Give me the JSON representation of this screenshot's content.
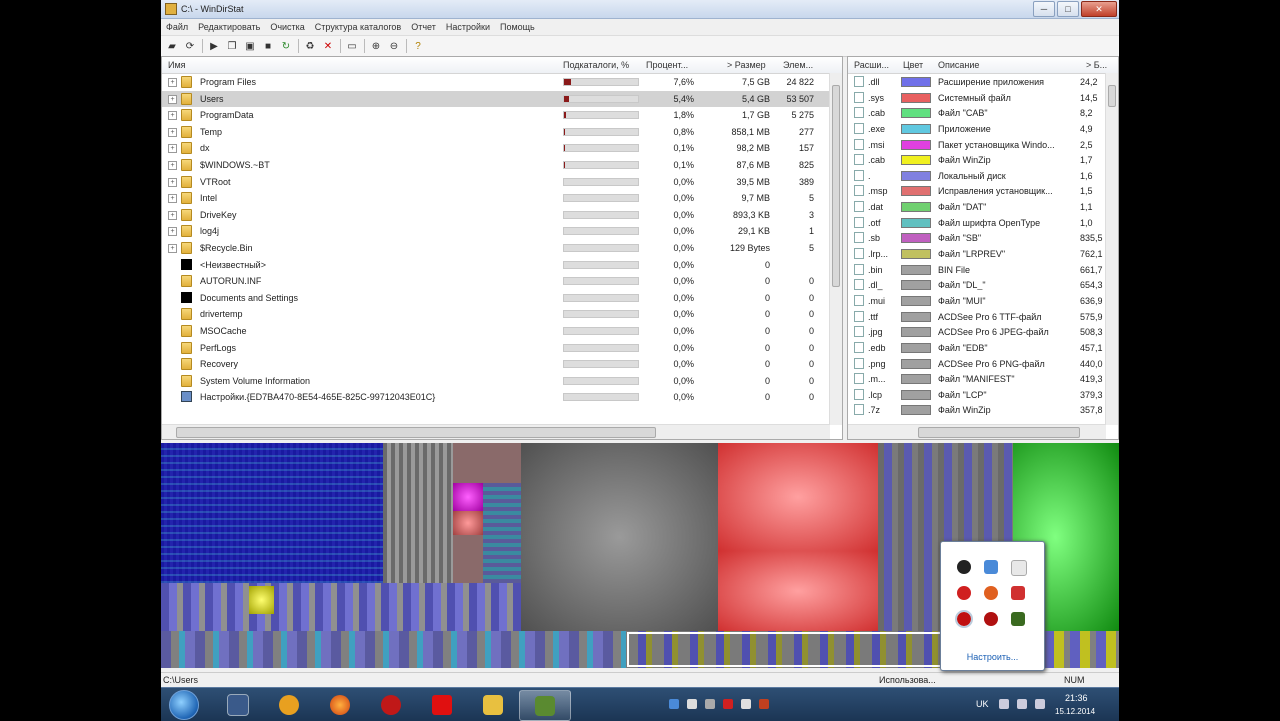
{
  "window": {
    "title": "C:\\ - WinDirStat",
    "min_label": "─",
    "max_label": "□",
    "close_label": "✕"
  },
  "menu": [
    "Файл",
    "Редактировать",
    "Очистка",
    "Структура каталогов",
    "Отчет",
    "Настройки",
    "Помощь"
  ],
  "toolbar": {
    "icons": [
      "open-icon",
      "refresh-icon",
      "play-icon",
      "copy-icon",
      "find-icon",
      "command-icon",
      "refresh-all-icon",
      "recycle-icon",
      "delete-icon",
      "folder-icon",
      "zoom-in-icon",
      "zoom-out-icon",
      "help-icon"
    ]
  },
  "tree": {
    "columns": {
      "name": "Имя",
      "subtree": "Подкаталоги, %",
      "percent": "Процент...",
      "size": "> Размер",
      "items": "Элем..."
    },
    "rows": [
      {
        "name": "Program Files",
        "icon": "folder",
        "expandable": true,
        "fill": 0.076,
        "percent": "7,6%",
        "size": "7,5 GB",
        "items": "24 822"
      },
      {
        "name": "Users",
        "icon": "folder",
        "expandable": true,
        "fill": 0.054,
        "percent": "5,4%",
        "size": "5,4 GB",
        "items": "53 507",
        "selected": true
      },
      {
        "name": "ProgramData",
        "icon": "folder",
        "expandable": true,
        "fill": 0.018,
        "percent": "1,8%",
        "size": "1,7 GB",
        "items": "5 275"
      },
      {
        "name": "Temp",
        "icon": "folder",
        "expandable": true,
        "fill": 0.008,
        "percent": "0,8%",
        "size": "858,1 MB",
        "items": "277"
      },
      {
        "name": "dx",
        "icon": "folder",
        "expandable": true,
        "fill": 0.001,
        "percent": "0,1%",
        "size": "98,2 MB",
        "items": "157"
      },
      {
        "name": "$WINDOWS.~BT",
        "icon": "folder",
        "expandable": true,
        "fill": 0.001,
        "percent": "0,1%",
        "size": "87,6 MB",
        "items": "825"
      },
      {
        "name": "VTRoot",
        "icon": "folder",
        "expandable": true,
        "fill": 0,
        "percent": "0,0%",
        "size": "39,5 MB",
        "items": "389"
      },
      {
        "name": "Intel",
        "icon": "folder",
        "expandable": true,
        "fill": 0,
        "percent": "0,0%",
        "size": "9,7 MB",
        "items": "5"
      },
      {
        "name": "DriveKey",
        "icon": "folder",
        "expandable": true,
        "fill": 0,
        "percent": "0,0%",
        "size": "893,3 KB",
        "items": "3"
      },
      {
        "name": "log4j",
        "icon": "folder",
        "expandable": true,
        "fill": 0,
        "percent": "0,0%",
        "size": "29,1 KB",
        "items": "1"
      },
      {
        "name": "$Recycle.Bin",
        "icon": "folder",
        "expandable": true,
        "fill": 0,
        "percent": "0,0%",
        "size": "129 Bytes",
        "items": "5"
      },
      {
        "name": "<Неизвестный>",
        "icon": "black",
        "expandable": false,
        "fill": 0,
        "percent": "0,0%",
        "size": "0",
        "items": ""
      },
      {
        "name": "AUTORUN.INF",
        "icon": "folder",
        "expandable": false,
        "fill": 0,
        "percent": "0,0%",
        "size": "0",
        "items": "0"
      },
      {
        "name": "Documents and Settings",
        "icon": "black",
        "expandable": false,
        "fill": 0,
        "percent": "0,0%",
        "size": "0",
        "items": "0"
      },
      {
        "name": "drivertemp",
        "icon": "folder",
        "expandable": false,
        "fill": 0,
        "percent": "0,0%",
        "size": "0",
        "items": "0"
      },
      {
        "name": "MSOCache",
        "icon": "folder",
        "expandable": false,
        "fill": 0,
        "percent": "0,0%",
        "size": "0",
        "items": "0"
      },
      {
        "name": "PerfLogs",
        "icon": "folder",
        "expandable": false,
        "fill": 0,
        "percent": "0,0%",
        "size": "0",
        "items": "0"
      },
      {
        "name": "Recovery",
        "icon": "folder",
        "expandable": false,
        "fill": 0,
        "percent": "0,0%",
        "size": "0",
        "items": "0"
      },
      {
        "name": "System Volume Information",
        "icon": "folder",
        "expandable": false,
        "fill": 0,
        "percent": "0,0%",
        "size": "0",
        "items": "0"
      },
      {
        "name": "Настройки.{ED7BA470-8E54-465E-825C-99712043E01C}",
        "icon": "link",
        "expandable": false,
        "fill": 0,
        "percent": "0,0%",
        "size": "0",
        "items": "0"
      }
    ]
  },
  "extensions": {
    "columns": {
      "ext": "Расши...",
      "color": "Цвет",
      "desc": "Описание",
      "bytes": "> Б..."
    },
    "rows": [
      {
        "ext": ".dll",
        "color": "#7070e8",
        "desc": "Расширение приложения",
        "bytes": "24,2"
      },
      {
        "ext": ".sys",
        "color": "#e86060",
        "desc": "Системный файл",
        "bytes": "14,5"
      },
      {
        "ext": ".cab",
        "color": "#60e080",
        "desc": "Файл \"CAB\"",
        "bytes": "8,2"
      },
      {
        "ext": ".exe",
        "color": "#60c8e0",
        "desc": "Приложение",
        "bytes": "4,9"
      },
      {
        "ext": ".msi",
        "color": "#e040e0",
        "desc": "Пакет установщика Windo...",
        "bytes": "2,5"
      },
      {
        "ext": ".cab",
        "color": "#f0f020",
        "desc": "Файл WinZip",
        "bytes": "1,7"
      },
      {
        "ext": ".",
        "color": "#8080e0",
        "desc": "Локальный диск",
        "bytes": "1,6"
      },
      {
        "ext": ".msp",
        "color": "#e07070",
        "desc": "Исправления установщик...",
        "bytes": "1,5"
      },
      {
        "ext": ".dat",
        "color": "#70d070",
        "desc": "Файл \"DAT\"",
        "bytes": "1,1"
      },
      {
        "ext": ".otf",
        "color": "#60c0c0",
        "desc": "Файл шрифта OpenType",
        "bytes": "1,0"
      },
      {
        "ext": ".sb",
        "color": "#c060c0",
        "desc": "Файл \"SB\"",
        "bytes": "835,5"
      },
      {
        "ext": ".lrp...",
        "color": "#c0c060",
        "desc": "Файл \"LRPREV\"",
        "bytes": "762,1"
      },
      {
        "ext": ".bin",
        "color": "#a0a0a0",
        "desc": "BIN File",
        "bytes": "661,7"
      },
      {
        "ext": ".dl_",
        "color": "#a0a0a0",
        "desc": "Файл \"DL_\"",
        "bytes": "654,3"
      },
      {
        "ext": ".mui",
        "color": "#a0a0a0",
        "desc": "Файл \"MUI\"",
        "bytes": "636,9"
      },
      {
        "ext": ".ttf",
        "color": "#a0a0a0",
        "desc": "ACDSee Pro 6 TTF-файл",
        "bytes": "575,9"
      },
      {
        "ext": ".jpg",
        "color": "#a0a0a0",
        "desc": "ACDSee Pro 6 JPEG-файл",
        "bytes": "508,3"
      },
      {
        "ext": ".edb",
        "color": "#a0a0a0",
        "desc": "Файл \"EDB\"",
        "bytes": "457,1"
      },
      {
        "ext": ".png",
        "color": "#a0a0a0",
        "desc": "ACDSee Pro 6 PNG-файл",
        "bytes": "440,0"
      },
      {
        "ext": ".m...",
        "color": "#a0a0a0",
        "desc": "Файл \"MANIFEST\"",
        "bytes": "419,3"
      },
      {
        "ext": ".lcp",
        "color": "#a0a0a0",
        "desc": "Файл \"LCP\"",
        "bytes": "379,3"
      },
      {
        "ext": ".7z",
        "color": "#a0a0a0",
        "desc": "Файл WinZip",
        "bytes": "357,8"
      }
    ]
  },
  "status": {
    "path": "C:\\Users",
    "usage": "Использова...",
    "num": "NUM"
  },
  "tray_popup": {
    "customize": "Настроить...",
    "icons": [
      "volume-icon",
      "network-icon",
      "flag-icon",
      "shield-icon",
      "sync-icon",
      "antivirus-icon",
      "record-icon",
      "media-icon",
      "nvidia-icon"
    ]
  },
  "taskbar": {
    "apps": [
      "start-orb",
      "headset-app-icon",
      "daemon-tools-icon",
      "firefox-icon",
      "media-player-icon",
      "yandex-icon",
      "explorer-icon",
      "windirstat-icon"
    ],
    "lang": "UK",
    "time": "21:36",
    "date": "15.12.2014"
  },
  "colors": {
    "selection": "#d2d2d2",
    "subtree_bar": "#8a1a1a",
    "taskbar": "#1b3554"
  }
}
